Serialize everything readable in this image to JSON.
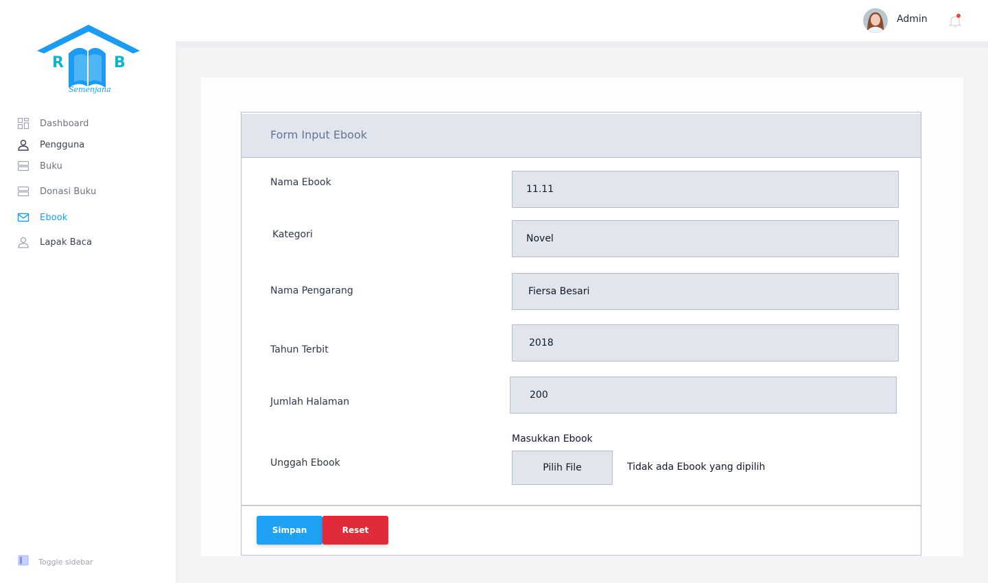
{
  "colors": {
    "accent": "#1d9bf0",
    "save_button": "#1ea1f2",
    "reset_button": "#e02c3a",
    "field_background": "#e1e6ee",
    "notification_dot": "#ef4444"
  },
  "logo": {
    "letters_left": "R",
    "letters_right": "B",
    "caption": "Semenjana",
    "icon": "book-house-logo"
  },
  "sidebar": {
    "items": [
      {
        "label": "Dashboard",
        "icon": "dashboard-grid-icon",
        "active": false
      },
      {
        "label": "Pengguna",
        "icon": "user-icon",
        "active": false
      },
      {
        "label": "Buku",
        "icon": "server-stack-icon",
        "active": false
      },
      {
        "label": "Donasi Buku",
        "icon": "server-stack-icon",
        "active": false
      },
      {
        "label": "Ebook",
        "icon": "mail-icon",
        "active": true
      },
      {
        "label": "Lapak Baca",
        "icon": "user-icon",
        "active": false
      }
    ],
    "toggle_label": "Toggle sidebar"
  },
  "topbar": {
    "user_name": "Admin",
    "avatar_icon": "user-avatar",
    "notification_icon": "bell-icon"
  },
  "form": {
    "title": "Form Input Ebook",
    "fields": [
      {
        "label": "Nama Ebook",
        "value": "11.11"
      },
      {
        "label": "Kategori",
        "value": "Novel"
      },
      {
        "label": "Nama Pengarang",
        "value": "Fiersa Besari"
      },
      {
        "label": "Tahun Terbit",
        "value": "2018"
      },
      {
        "label": "Jumlah Halaman",
        "value": "200"
      }
    ],
    "upload": {
      "label": "Unggah Ebook",
      "caption": "Masukkan Ebook",
      "button": "Pilih File",
      "status": "Tidak ada Ebook yang dipilih"
    },
    "buttons": {
      "save": "Simpan",
      "reset": "Reset"
    }
  }
}
